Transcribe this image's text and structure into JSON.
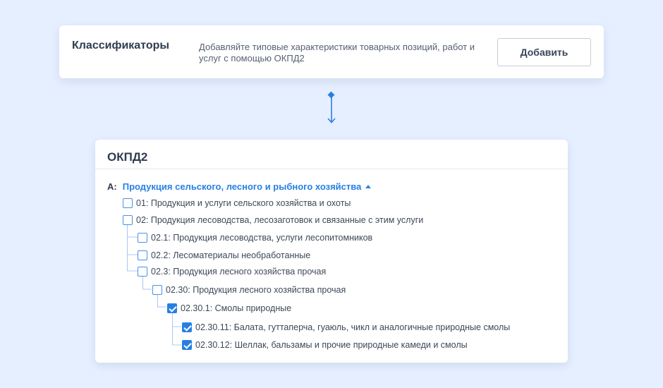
{
  "header": {
    "title": "Классификаторы",
    "description": "Добавляйте типовые характеристики товарных позиций, работ и услуг с помощью ОКПД2",
    "add_label": "Добавить"
  },
  "classifier": {
    "title": "ОКПД2",
    "section": {
      "code": "А:",
      "label": "Продукция сельского, лесного и рыбного хозяйства"
    },
    "items": [
      {
        "label": "01: Продукция и услуги сельского хозяйства и охоты",
        "checked": false
      },
      {
        "label": "02: Продукция лесоводства, лесозаготовок и связанные с этим услуги",
        "checked": false
      },
      {
        "label": "02.1: Продукция лесоводства, услуги лесопитомников",
        "checked": false
      },
      {
        "label": "02.2: Лесоматериалы необработанные",
        "checked": false
      },
      {
        "label": "02.3: Продукция лесного хозяйства прочая",
        "checked": false
      },
      {
        "label": "02.30: Продукция лесного хозяйства прочая",
        "checked": false
      },
      {
        "label": "02.30.1: Смолы природные",
        "checked": true
      },
      {
        "label": "02.30.11: Балата, гуттаперча, гуаюль, чикл и аналогичные природные смолы",
        "checked": true
      },
      {
        "label": "02.30.12: Шеллак, бальзамы и прочие природные камеди и смолы",
        "checked": true
      }
    ]
  },
  "colors": {
    "accent": "#2680e4",
    "background": "#e6efff",
    "tree_line": "#a9c8f0"
  }
}
